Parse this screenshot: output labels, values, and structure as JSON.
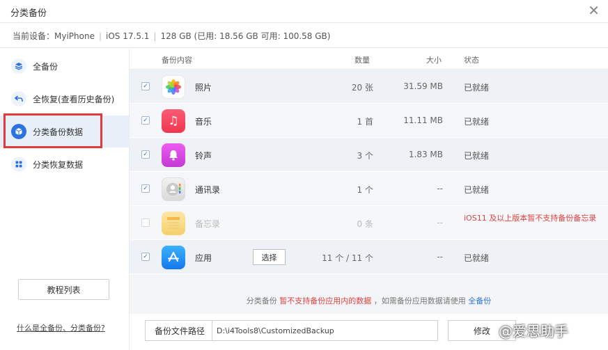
{
  "window": {
    "title": "分类备份",
    "close_glyph": "✕"
  },
  "device": {
    "label": "当前设备：",
    "name": "MyiPhone",
    "ios": "iOS 17.5.1",
    "storage": "128 GB (已用: 18.56 GB 可用: 100.58 GB)",
    "separator": "|"
  },
  "sidebar": {
    "items": [
      {
        "label": "全备份",
        "icon": "layers-icon"
      },
      {
        "label": "全恢复(查看历史备份)",
        "icon": "undo-arrow-icon"
      },
      {
        "label": "分类备份数据",
        "icon": "cube-icon",
        "active": true
      },
      {
        "label": "分类恢复数据",
        "icon": "grid-icon"
      }
    ],
    "tutorial_button": "教程列表",
    "help_link": "什么是全备份、分类备份?"
  },
  "table": {
    "headers": {
      "content": "备份内容",
      "count": "数量",
      "size": "大小",
      "status": "状态"
    },
    "rows": [
      {
        "name": "照片",
        "count": "20 张",
        "size": "31.59 MB",
        "status": "已就绪",
        "checked": true,
        "icon": "photos-icon"
      },
      {
        "name": "音乐",
        "count": "1 首",
        "size": "11.11 MB",
        "status": "已就绪",
        "checked": true,
        "icon": "music-icon"
      },
      {
        "name": "铃声",
        "count": "3 个",
        "size": "1.83 MB",
        "status": "已就绪",
        "checked": true,
        "icon": "bell-icon"
      },
      {
        "name": "通讯录",
        "count": "1 个",
        "size": "--",
        "status": "已就绪",
        "checked": true,
        "icon": "contacts-icon"
      },
      {
        "name": "备忘录",
        "count": "0 条",
        "size": "--",
        "status": "iOS11 及以上版本暂不支持备份备忘录",
        "checked": false,
        "disabled": true,
        "icon": "notes-icon"
      },
      {
        "name": "应用",
        "count": "11 个 / 11 个",
        "size": "--",
        "status": "已就绪",
        "checked": true,
        "icon": "app-store-icon",
        "action_button": "选择"
      }
    ]
  },
  "note": {
    "prefix": "分类备份",
    "warning": "暂不支持备份应用内的数据",
    "middle": "，如需备份应用数据请使用",
    "link": "全备份"
  },
  "path": {
    "label": "备份文件路径",
    "value": "D:\\i4Tools8\\CustomizedBackup",
    "modify_button": "修改"
  },
  "watermark": "@爱思助手",
  "colors": {
    "accent": "#2b74e0",
    "warning": "#e04040",
    "highlight_box": "#e23a3a"
  }
}
